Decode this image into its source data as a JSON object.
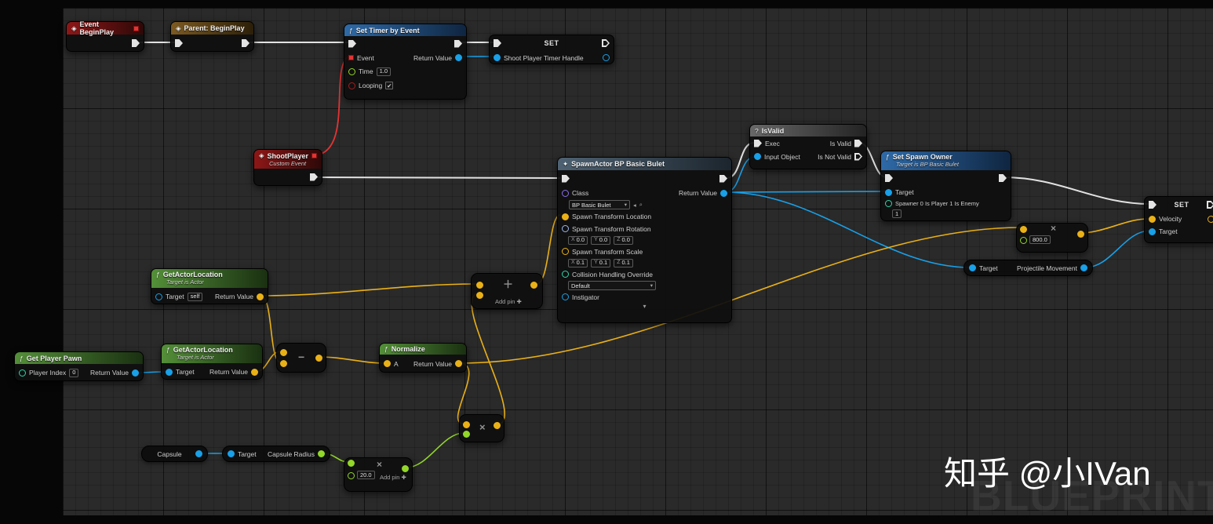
{
  "colors": {
    "background": "#2a2a2a",
    "wires": {
      "exec": "#e2e2e2",
      "object": "#18a0e8",
      "vector": "#eab117",
      "float": "#92d729",
      "delegate": "#e23434"
    },
    "pin_object": "#18a0e8",
    "pin_vector": "#eab117",
    "pin_float": "#92d729",
    "pin_int": "#2fd6a8",
    "pin_bool": "#a41c1c",
    "pin_class": "#8a6fe8",
    "pin_enum": "#2fd6a8",
    "pin_rotator": "#9db8ef"
  },
  "icons": {
    "event": "◈",
    "function": "ƒ",
    "question": "?",
    "spawn": "✦",
    "dropdown": "▾",
    "collapse": "▾",
    "check": "✔",
    "use_asset": "◂",
    "browse_asset": "⌕",
    "add_pin": "✚"
  },
  "watermark": {
    "brand": "知乎 @小IVan",
    "ghost": "BLUEPRINT"
  },
  "nodes": {
    "event_begin_play": {
      "title": "Event BeginPlay"
    },
    "parent_begin_play": {
      "title": "Parent: BeginPlay"
    },
    "set_timer_by_event": {
      "title": "Set Timer by Event",
      "event_label": "Event",
      "return_label": "Return Value",
      "time_label": "Time",
      "time_value": "1.0",
      "looping_label": "Looping"
    },
    "set_timer_handle": {
      "title": "SET",
      "pin_label": "Shoot Player Timer Handle"
    },
    "shoot_player": {
      "title": "ShootPlayer",
      "subtitle": "Custom Event"
    },
    "spawn_actor": {
      "title": "SpawnActor BP Basic Bulet",
      "class_label": "Class",
      "class_value": "BP Basic Bulet",
      "return_label": "Return Value",
      "location_label": "Spawn Transform Location",
      "rotation_label": "Spawn Transform Rotation",
      "scale_label": "Spawn Transform Scale",
      "collision_label": "Collision Handling Override",
      "collision_value": "Default",
      "instigator_label": "Instigator",
      "axis_x": "X",
      "axis_y": "Y",
      "axis_z": "Z",
      "rotation_x": "0.0",
      "rotation_y": "0.0",
      "rotation_z": "0.0",
      "scale_x": "0.1",
      "scale_y": "0.1",
      "scale_z": "0.1"
    },
    "is_valid": {
      "title": "IsValid",
      "exec_label": "Exec",
      "input_object_label": "Input Object",
      "is_valid_label": "Is Valid",
      "is_not_valid_label": "Is Not Valid"
    },
    "set_spawn_owner": {
      "title": "Set Spawn Owner",
      "subtitle": "Target is BP Basic Bulet",
      "target_label": "Target",
      "spawner_label": "Spawner 0 Is Player 1 Is Enemy",
      "spawner_value": "1"
    },
    "set_velocity": {
      "title": "SET",
      "velocity_label": "Velocity",
      "target_label": "Target"
    },
    "get_actor_location_self": {
      "title": "GetActorLocation",
      "subtitle": "Target is Actor",
      "target_label": "Target",
      "target_value": "self",
      "return_label": "Return Value"
    },
    "get_player_pawn": {
      "title": "Get Player Pawn",
      "player_index_label": "Player Index",
      "player_index_value": "0",
      "return_label": "Return Value"
    },
    "get_actor_location_player": {
      "title": "GetActorLocation",
      "subtitle": "Target is Actor",
      "target_label": "Target",
      "return_label": "Return Value"
    },
    "subtract": {
      "operator": "−"
    },
    "normalize": {
      "title": "Normalize",
      "a_label": "A",
      "return_label": "Return Value"
    },
    "add_vector": {
      "operator": "＋",
      "add_pin_label": "Add pin"
    },
    "multiply_direction": {
      "operator": "×"
    },
    "capsule": {
      "title": "Capsule"
    },
    "capsule_radius": {
      "target_label": "Target",
      "output_label": "Capsule Radius"
    },
    "multiply_radius": {
      "operator": "×",
      "value": "20.0",
      "add_pin_label": "Add pin"
    },
    "multiply_speed": {
      "operator": "×",
      "value": "800.0"
    },
    "projectile_movement": {
      "target_label": "Target",
      "output_label": "Projectile Movement"
    }
  }
}
